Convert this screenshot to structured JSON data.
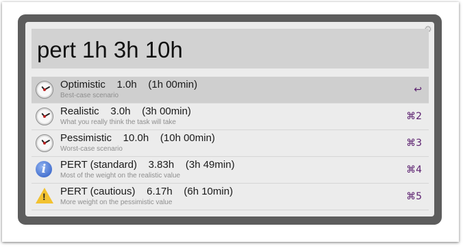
{
  "query": "pert 1h 3h 10h",
  "settings_icon": "gear-icon",
  "results": [
    {
      "icon": "clock-icon",
      "title": "Optimistic    1.0h    (1h 00min)",
      "subtitle": "Best-case scenario",
      "shortcut": "↩",
      "selected": true
    },
    {
      "icon": "clock-icon",
      "title": "Realistic    3.0h    (3h 00min)",
      "subtitle": "What you really think the task will take",
      "shortcut": "⌘2"
    },
    {
      "icon": "clock-icon",
      "title": "Pessimistic    10.0h    (10h 00min)",
      "subtitle": "Worst-case scenario",
      "shortcut": "⌘3"
    },
    {
      "icon": "info-icon",
      "title": "PERT (standard)    3.83h    (3h 49min)",
      "subtitle": "Most of the weight on the realistic value",
      "shortcut": "⌘4"
    },
    {
      "icon": "warning-icon",
      "title": "PERT (cautious)    6.17h    (6h 10min)",
      "subtitle": "More weight on the pessimistic value",
      "shortcut": "⌘5"
    }
  ]
}
